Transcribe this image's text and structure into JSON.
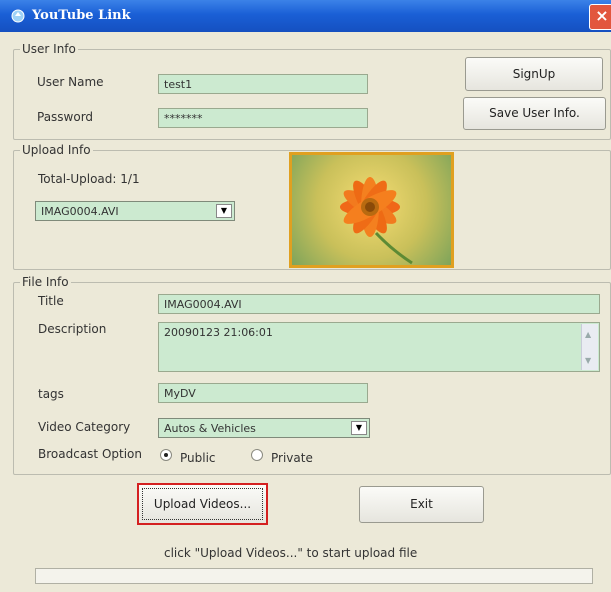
{
  "window": {
    "title": "YouTube Link",
    "close_glyph": "×"
  },
  "user_info": {
    "legend": "User Info",
    "username_label": "User Name",
    "username_value": "test1",
    "password_label": "Password",
    "password_value": "*******",
    "signup_label": "SignUp",
    "save_label": "Save User Info."
  },
  "upload_info": {
    "legend": "Upload Info",
    "total_label": "Total-Upload: 1/1",
    "selected_file": "IMAG0004.AVI"
  },
  "file_info": {
    "legend": "File Info",
    "title_label": "Title",
    "title_value": "IMAG0004.AVI",
    "description_label": "Description",
    "description_value": "20090123 21:06:01",
    "tags_label": "tags",
    "tags_value": "MyDV",
    "category_label": "Video Category",
    "category_value": "Autos & Vehicles",
    "broadcast_label": "Broadcast Option",
    "option_public": "Public",
    "option_private": "Private",
    "selected_option": "Public"
  },
  "actions": {
    "upload_label": "Upload Videos...",
    "exit_label": "Exit",
    "hint": "click \"Upload Videos...\" to start  upload file"
  },
  "colors": {
    "titlebar": "#1a5fd6",
    "field_bg": "#ccead0",
    "focus_border": "#d42020",
    "thumbnail_frame": "#e0a020"
  }
}
